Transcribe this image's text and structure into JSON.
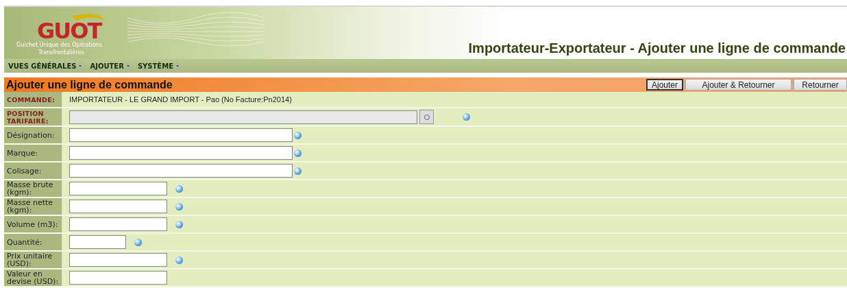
{
  "header": {
    "logo": "GUOT",
    "logo_subtitle": [
      "Guichet Unique des Opérations",
      "Transfrontalières"
    ],
    "page_title": "Importateur-Exportateur - Ajouter une ligne de commande"
  },
  "menu": [
    {
      "label": "VUES GÉNÉRALES"
    },
    {
      "label": "AJOUTER"
    },
    {
      "label": "SYSTÈME"
    }
  ],
  "form": {
    "title": "Ajouter une ligne de commande",
    "buttons": [
      {
        "label": "Ajouter",
        "focused": true
      },
      {
        "label": "Ajouter & Retourner",
        "focused": false
      },
      {
        "label": "Retourner",
        "focused": false
      }
    ],
    "rows": [
      {
        "label": "COMMANDE:",
        "emphasis": true,
        "kind": "text",
        "value": "IMPORTATEUR - LE GRAND IMPORT - Pao (No Facture:Pn2014)"
      },
      {
        "label": "POSITION TARIFAIRE:",
        "emphasis": true,
        "kind": "lookup",
        "help": true
      },
      {
        "label": "Désignation:",
        "emphasis": false,
        "kind": "wide",
        "help": true
      },
      {
        "label": "Marque:",
        "emphasis": false,
        "kind": "wide",
        "help": true
      },
      {
        "label": "Colisage:",
        "emphasis": false,
        "kind": "wide",
        "help": true
      },
      {
        "label": "Masse brute (kgm):",
        "emphasis": false,
        "kind": "medium",
        "help": true
      },
      {
        "label": "Masse nette (kgm):",
        "emphasis": false,
        "kind": "medium",
        "help": true
      },
      {
        "label": "Volume (m3):",
        "emphasis": false,
        "kind": "medium",
        "help": true
      },
      {
        "label": "Quantité:",
        "emphasis": false,
        "kind": "narrow",
        "help": true
      },
      {
        "label": "Prix unitaire (USD):",
        "emphasis": false,
        "kind": "medium",
        "help": true
      },
      {
        "label": "Valeur en devise (USD):",
        "emphasis": false,
        "kind": "medium",
        "help": false
      }
    ]
  }
}
